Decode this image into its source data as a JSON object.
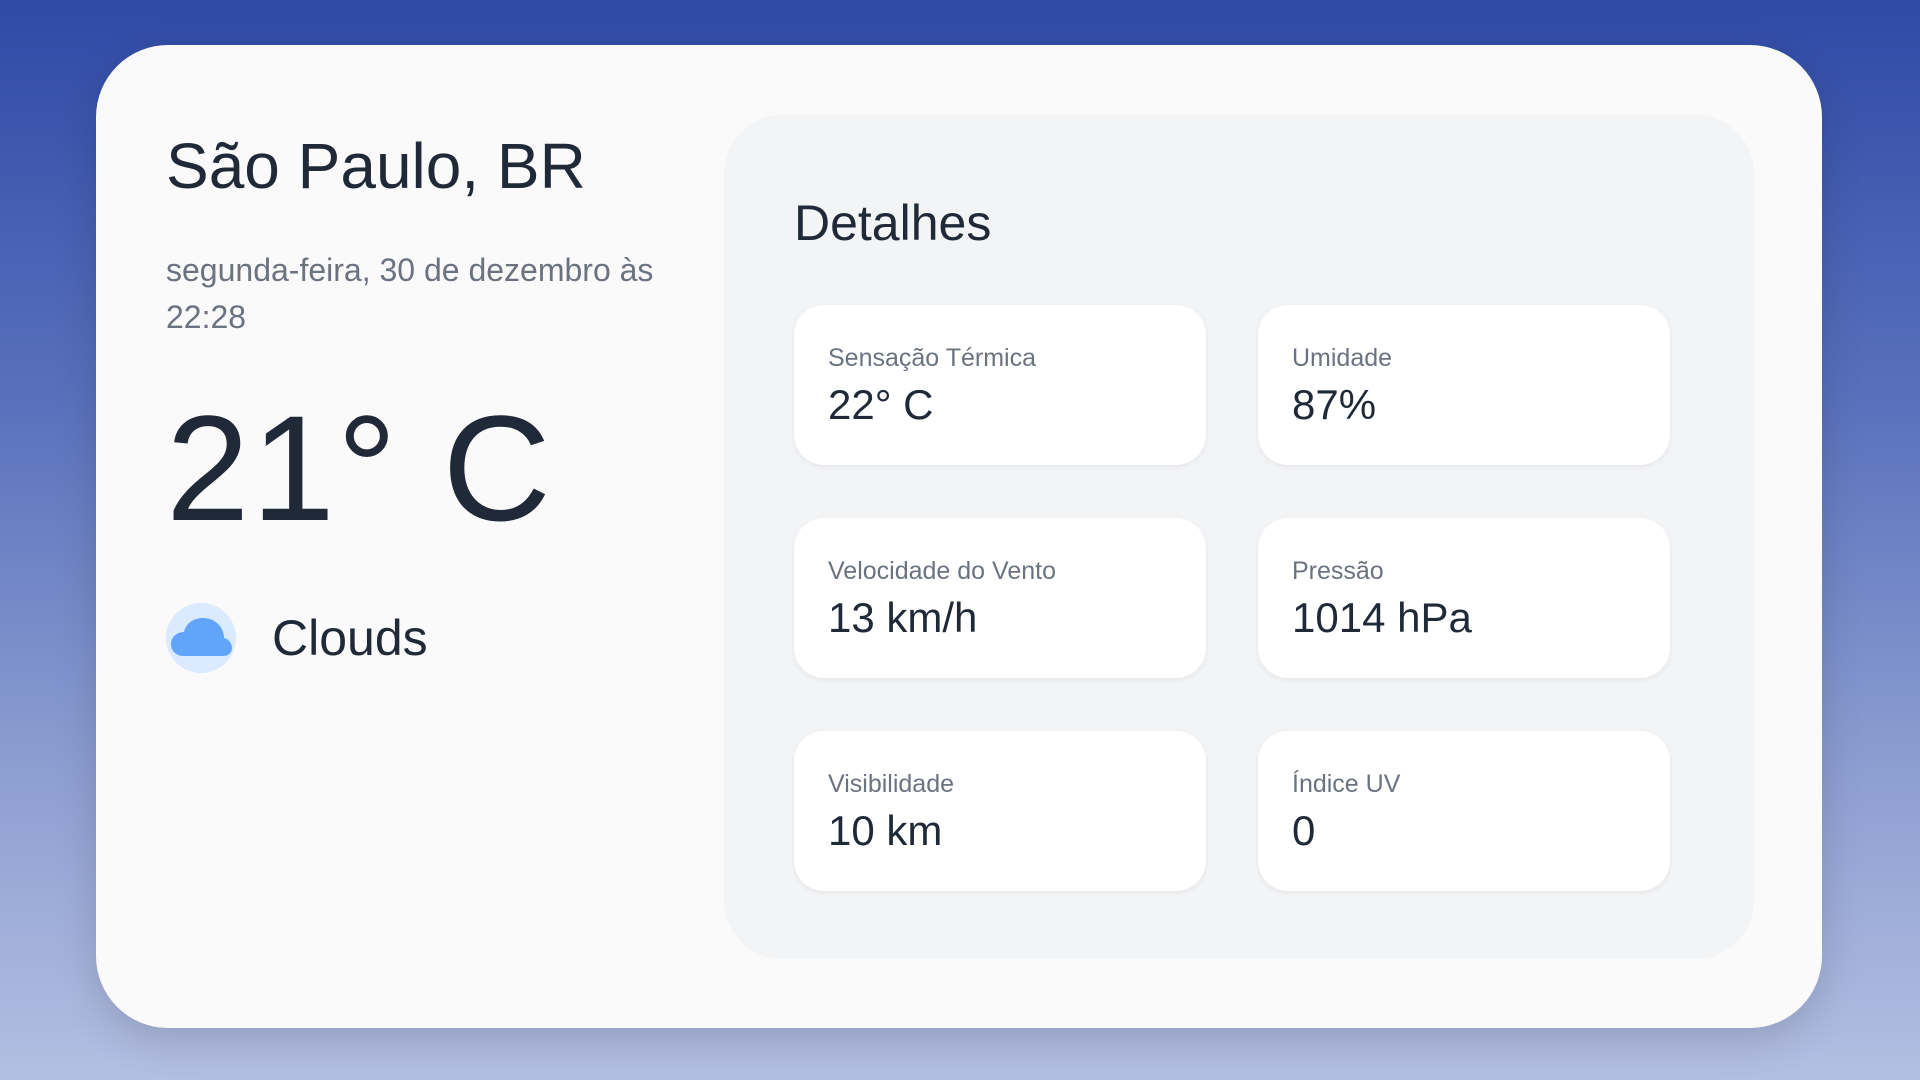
{
  "location": {
    "city": "São Paulo, BR",
    "datetime": "segunda-feira, 30 de dezembro às 22:28"
  },
  "current": {
    "temperature": "21° C",
    "condition": "Clouds",
    "condition_icon": "cloud-icon"
  },
  "details": {
    "title": "Detalhes",
    "items": [
      {
        "label": "Sensação Térmica",
        "value": "22° C"
      },
      {
        "label": "Umidade",
        "value": "87%"
      },
      {
        "label": "Velocidade do Vento",
        "value": "13 km/h"
      },
      {
        "label": "Pressão",
        "value": "1014 hPa"
      },
      {
        "label": "Visibilidade",
        "value": "10 km"
      },
      {
        "label": "Índice UV",
        "value": "0"
      }
    ]
  },
  "colors": {
    "background_top": "#2f4aa6",
    "background_bottom": "#b3bfe2",
    "card": "#fafafa",
    "panel": "#f3f4f6",
    "cloud_icon": "#60a5fa",
    "cloud_icon_bg": "#dbeafe",
    "text_primary": "#1f2937",
    "text_secondary": "#6b7280"
  }
}
